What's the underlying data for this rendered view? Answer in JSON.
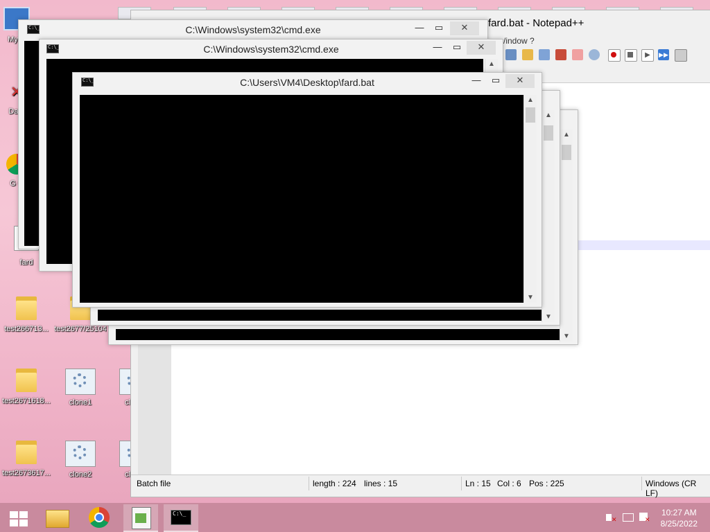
{
  "desktop": {
    "icons": [
      {
        "label": "My C"
      },
      {
        "label": "Data"
      },
      {
        "label": "G C"
      },
      {
        "label": "fard"
      },
      {
        "label": "test266713..."
      },
      {
        "label": "test2677/25104"
      },
      {
        "label": "test2671618..."
      },
      {
        "label": "clone1"
      },
      {
        "label": "cl"
      },
      {
        "label": "test2673617..."
      },
      {
        "label": "clone2"
      },
      {
        "label": "cl"
      }
    ]
  },
  "notepadpp": {
    "title": "fard.bat - Notepad++",
    "menu": "/indow   ?",
    "status": {
      "filetype": "Batch file",
      "length": "length : 224",
      "lines": "lines : 15",
      "ln": "Ln : 15",
      "col": "Col : 6",
      "pos": "Pos : 225",
      "eol": "Windows (CR LF)"
    }
  },
  "windows": {
    "cmd1_title": "C:\\Windows\\system32\\cmd.exe",
    "cmd2_title": "C:\\Windows\\system32\\cmd.exe",
    "bat_title": "C:\\Users\\VM4\\Desktop\\fard.bat"
  },
  "taskbar": {
    "time": "10:27 AM",
    "date": "8/25/2022",
    "items": [
      "start-button",
      "file-explorer",
      "chrome",
      "notepad-plus-plus",
      "command-prompt"
    ]
  },
  "colors": {
    "desktop_bg": "#f2b9cc",
    "taskbar": "#c98a9e",
    "console": "#000000"
  }
}
